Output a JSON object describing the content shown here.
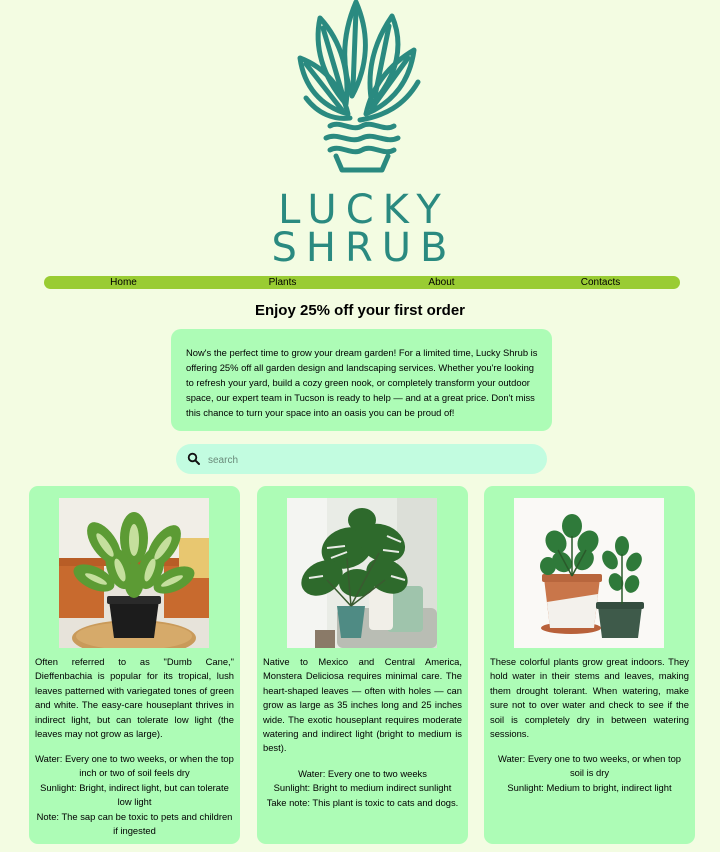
{
  "brand": {
    "line1": "LUCKY",
    "line2": "SHRUB",
    "logo_icon": "plant-in-pot-icon",
    "color": "#2a8a80"
  },
  "nav": {
    "items": [
      "Home",
      "Plants",
      "About",
      "Contacts"
    ],
    "color": "#99cc33"
  },
  "headline": "Enjoy 25% off your first order",
  "promo": {
    "text": "Now's the perfect time to grow your dream garden! For a limited time, Lucky Shrub is offering 25% off all garden design and landscaping services. Whether you're looking to refresh your yard, build a cozy green nook, or completely transform your outdoor space, our expert team in Tucson is ready to help — and at a great price. Don't miss this chance to turn your space into an oasis you can be proud of!"
  },
  "search": {
    "placeholder": "search",
    "icon": "search-icon"
  },
  "plants": [
    {
      "image": "dieffenbachia-photo",
      "description": "Often referred to as \"Dumb Cane,\" Dieffenbachia is popular for its tropical, lush leaves patterned with variegated tones of green and white. The easy-care houseplant thrives in indirect light, but can tolerate low light (the leaves may not grow as large).",
      "care": [
        "Water: Every one to two weeks, or when the top inch or two of soil feels dry",
        "Sunlight: Bright, indirect light, but can tolerate low light",
        "Note: The sap can be toxic to pets and children if ingested"
      ]
    },
    {
      "image": "monstera-photo",
      "description": "Native to Mexico and Central America, Monstera Deliciosa requires minimal care. The heart-shaped leaves — often with holes — can grow as large as 35 inches long and 25 inches wide. The exotic houseplant requires moderate watering and indirect light (bright to medium is best).",
      "care": [
        "Water: Every one to two weeks",
        "Sunlight: Bright to medium indirect sunlight",
        "Take note: This plant is toxic to cats and dogs."
      ]
    },
    {
      "image": "peperomia-photo",
      "description": "These colorful plants grow great indoors. They hold water in their stems and leaves, making them drought tolerant. When watering, make sure not to over water and check to see if the soil is completely dry in between watering sessions.",
      "care": [
        "Water: Every one to two weeks, or when top soil is dry",
        "Sunlight: Medium to bright, indirect light"
      ]
    }
  ]
}
